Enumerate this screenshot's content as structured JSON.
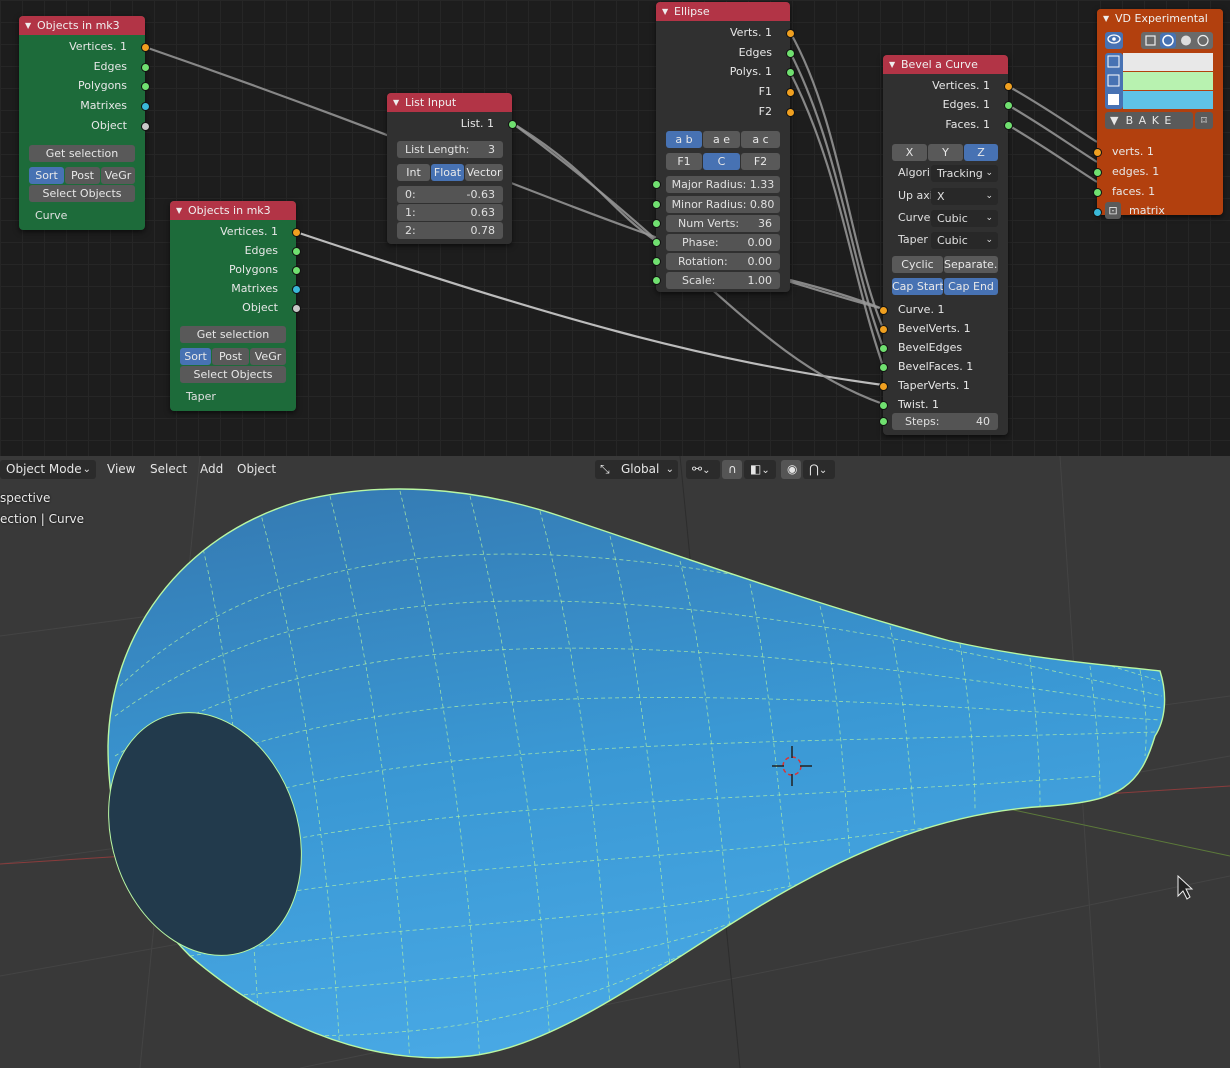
{
  "node_editor": {
    "objects_node_1": {
      "title": "Objects in mk3",
      "outputs": [
        "Vertices. 1",
        "Edges",
        "Polygons",
        "Matrixes",
        "Object"
      ],
      "get_selection": "Get selection",
      "toggles": [
        "Sort",
        "Post",
        "VeGr"
      ],
      "select_objects": "Select Objects",
      "object_name": "Curve"
    },
    "objects_node_2": {
      "title": "Objects in mk3",
      "outputs": [
        "Vertices. 1",
        "Edges",
        "Polygons",
        "Matrixes",
        "Object"
      ],
      "get_selection": "Get selection",
      "toggles": [
        "Sort",
        "Post",
        "VeGr"
      ],
      "select_objects": "Select Objects",
      "object_name": "Taper"
    },
    "list_input": {
      "title": "List Input",
      "output": "List. 1",
      "list_length_label": "List Length:",
      "list_length_value": "3",
      "modes": [
        "Int",
        "Float",
        "Vector"
      ],
      "items": [
        {
          "label": "0:",
          "value": "-0.63"
        },
        {
          "label": "1:",
          "value": "0.63"
        },
        {
          "label": "2:",
          "value": "0.78"
        }
      ]
    },
    "ellipse": {
      "title": "Ellipse",
      "outputs": [
        "Verts. 1",
        "Edges",
        "Polys. 1",
        "F1",
        "F2"
      ],
      "mode_buttons": [
        "a b",
        "a e",
        "a c"
      ],
      "center_buttons": [
        "F1",
        "C",
        "F2"
      ],
      "params": [
        {
          "label": "Major Radius:",
          "value": "1.33"
        },
        {
          "label": "Minor Radius:",
          "value": "0.80"
        },
        {
          "label": "Num Verts:",
          "value": "36"
        },
        {
          "label": "Phase:",
          "value": "0.00"
        },
        {
          "label": "Rotation:",
          "value": "0.00"
        },
        {
          "label": "Scale:",
          "value": "1.00"
        }
      ]
    },
    "bevel_curve": {
      "title": "Bevel a Curve",
      "outputs": [
        "Vertices. 1",
        "Edges. 1",
        "Faces. 1"
      ],
      "axes": [
        "X",
        "Y",
        "Z"
      ],
      "algorithm_label": "Algori",
      "algorithm_value": "Tracking",
      "up_axis_label": "Up axi",
      "up_axis_value": "X",
      "curve_label": "Curve",
      "curve_value": "Cubic",
      "taper_label": "Taper",
      "taper_value": "Cubic",
      "cyclic": "Cyclic",
      "separate": "Separate..",
      "cap_start": "Cap Start",
      "cap_end": "Cap End",
      "inputs": [
        "Curve. 1",
        "BevelVerts. 1",
        "BevelEdges",
        "BevelFaces. 1",
        "TaperVerts. 1",
        "Twist. 1"
      ],
      "steps_label": "Steps:",
      "steps_value": "40"
    },
    "vd_experimental": {
      "title": "VD Experimental",
      "bake": "B A K E",
      "inputs": [
        "verts. 1",
        "edges. 1",
        "faces. 1",
        "matrix"
      ],
      "swatch_colors": [
        "#e8e8e8",
        "#b8f2b0",
        "#5fc3e6"
      ]
    }
  },
  "viewport": {
    "mode": "Object Mode",
    "menus": [
      "View",
      "Select",
      "Add",
      "Object"
    ],
    "orientation": "Global",
    "overlay_line1": "spective",
    "overlay_line2": "ection | Curve",
    "mesh_color": "#3a98d4",
    "wire_color": "#b9f7a3"
  }
}
